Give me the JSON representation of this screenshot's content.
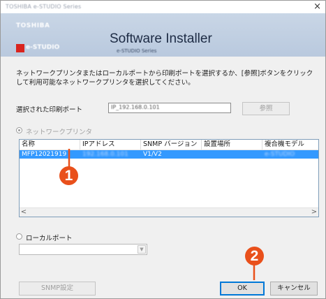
{
  "window": {
    "title": "TOSHIBA e-STUDIO Series",
    "close_glyph": "×"
  },
  "banner": {
    "brand_top": "TOSHIBA",
    "brand_bottom": "e-STUDIO",
    "app_title": "Software Installer",
    "app_subtitle": "e-STUDIO Series"
  },
  "instruction": "ネットワークプリンタまたはローカルポートから印刷ポートを選択するか、[参照]ボタンをクリックして利用可能なネットワークプリンタを選択してください。",
  "port": {
    "label": "選択された印刷ポート",
    "value": "IP_192.168.0.101",
    "browse_label": "参照"
  },
  "network_option": {
    "label": "ネットワークプリンタ",
    "checked": true
  },
  "printer_list": {
    "columns": [
      "名称",
      "IPアドレス",
      "SNMP バージョン",
      "設置場所",
      "複合機モデル"
    ],
    "rows": [
      [
        "MFP12021919",
        "192.168.0.101",
        "V1/V2",
        "",
        "e-STUDIO"
      ]
    ],
    "scroll_left": "<",
    "scroll_right": ">"
  },
  "local_option": {
    "label": "ローカルポート",
    "checked": false
  },
  "buttons": {
    "snmp": "SNMP設定",
    "ok": "OK",
    "cancel": "キャンセル"
  },
  "callouts": {
    "one": "1",
    "two": "2"
  },
  "colors": {
    "accent": "#e9501b",
    "selection": "#3399ff"
  }
}
